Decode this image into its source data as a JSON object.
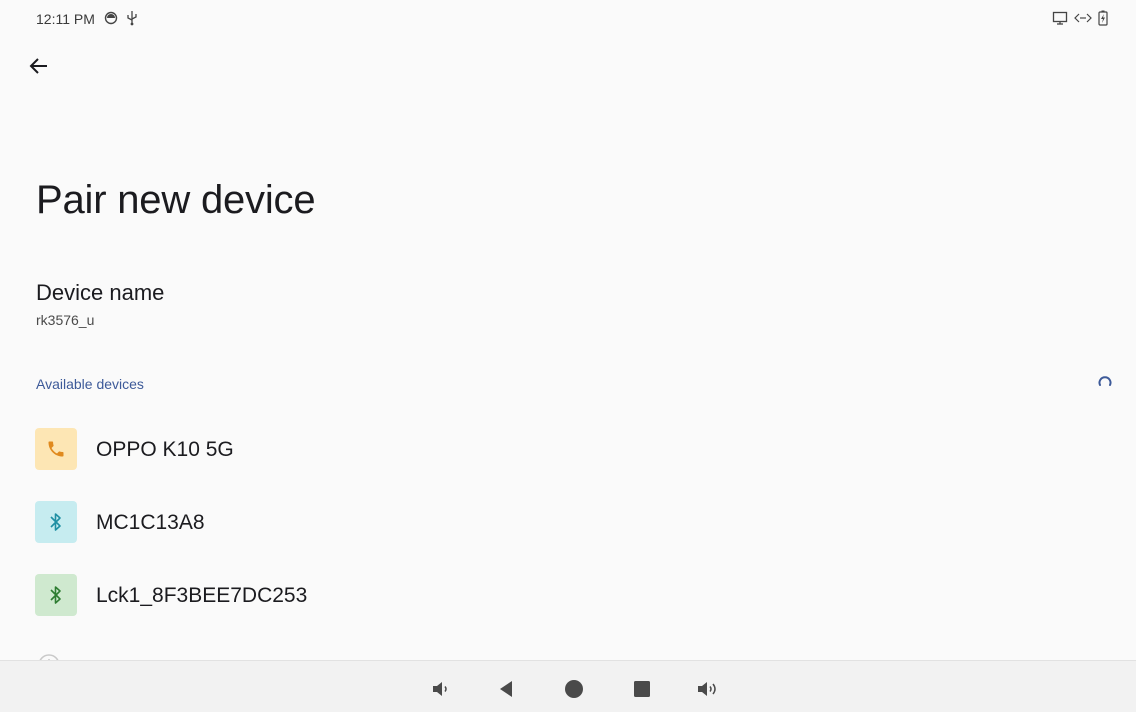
{
  "status_bar": {
    "time": "12:11 PM",
    "left_icons": [
      "sync-icon",
      "usb-icon"
    ],
    "right_icons": [
      "screen-cast-icon",
      "data-transfer-icon",
      "battery-charging-icon"
    ]
  },
  "header": {
    "back_icon": "back-arrow-icon"
  },
  "page": {
    "title": "Pair new device"
  },
  "device_name": {
    "title": "Device name",
    "value": "rk3576_u"
  },
  "available_devices": {
    "header": "Available devices",
    "scanning_icon": "progress-spinner-icon",
    "items": [
      {
        "label": "OPPO K10 5G",
        "icon": "phone-icon",
        "icon_bg": "#fde6b4",
        "icon_color": "#e08a1e"
      },
      {
        "label": "MC1C13A8",
        "icon": "bluetooth-icon",
        "icon_bg": "#c6ecf0",
        "icon_color": "#1f8fa3"
      },
      {
        "label": "Lck1_8F3BEE7DC253",
        "icon": "bluetooth-icon",
        "icon_bg": "#cfe9cf",
        "icon_color": "#2e7d32"
      }
    ]
  },
  "nav_bar": {
    "buttons": [
      "volume-down-icon",
      "back-triangle-icon",
      "home-circle-icon",
      "recents-square-icon",
      "volume-up-icon"
    ]
  },
  "colors": {
    "accent": "#3d5a99",
    "background": "#fafafa",
    "nav_bar": "#f2f2f2"
  }
}
